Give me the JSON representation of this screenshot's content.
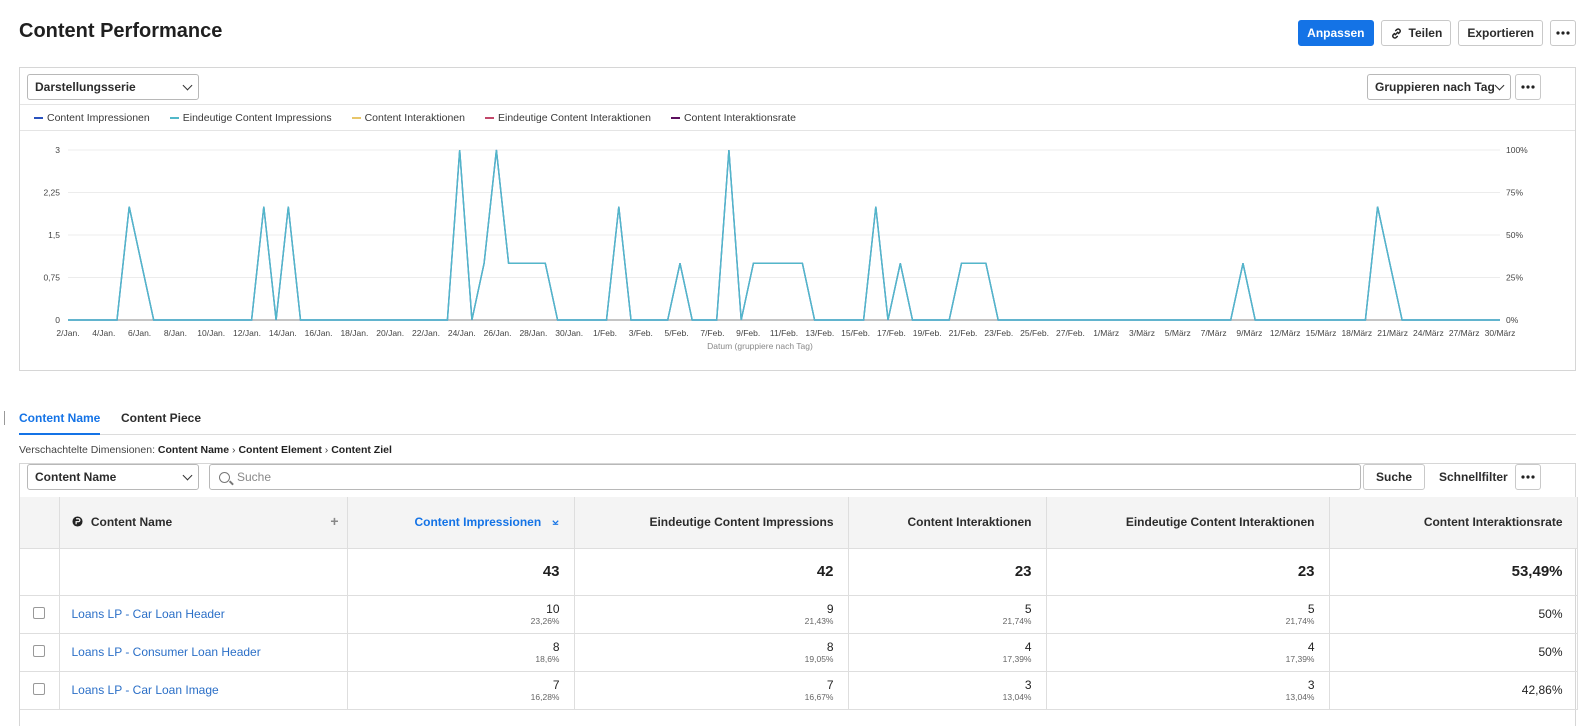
{
  "header": {
    "title": "Content Performance",
    "btn_customize": "Anpassen",
    "btn_share": "Teilen",
    "btn_export": "Exportieren",
    "more_icon": "more-icon"
  },
  "chart_panel": {
    "series_select": "Darstellungsserie",
    "group_select": "Gruppieren nach Tag"
  },
  "chart_data": {
    "type": "line",
    "xlabel": "Datum (gruppiere nach Tag)",
    "x_ticks": [
      "2/Jan.",
      "4/Jan.",
      "6/Jan.",
      "8/Jan.",
      "10/Jan.",
      "12/Jan.",
      "14/Jan.",
      "16/Jan.",
      "18/Jan.",
      "20/Jan.",
      "22/Jan.",
      "24/Jan.",
      "26/Jan.",
      "28/Jan.",
      "30/Jan.",
      "1/Feb.",
      "3/Feb.",
      "5/Feb.",
      "7/Feb.",
      "9/Feb.",
      "11/Feb.",
      "13/Feb.",
      "15/Feb.",
      "17/Feb.",
      "19/Feb.",
      "21/Feb.",
      "23/Feb.",
      "25/Feb.",
      "27/Feb.",
      "1/März",
      "3/März",
      "5/März",
      "7/März",
      "9/März",
      "12/März",
      "15/März",
      "18/März",
      "21/März",
      "24/März",
      "27/März",
      "30/März"
    ],
    "y_ticks_left": [
      "0",
      "0,75",
      "1,5",
      "2,25",
      "3"
    ],
    "y_ticks_right": [
      "0%",
      "25%",
      "50%",
      "75%",
      "100%"
    ],
    "ylim": [
      0,
      3
    ],
    "y2lim": [
      0,
      100
    ],
    "days": 89,
    "series": [
      {
        "name": "Content Impressionen",
        "color": "#2a52be",
        "values": [
          0,
          0,
          0,
          0,
          0,
          2,
          1,
          0,
          0,
          0,
          0,
          0,
          0,
          0,
          0,
          0,
          2,
          0,
          2,
          0,
          0,
          0,
          0,
          0,
          0,
          0,
          0,
          0,
          0,
          0,
          0,
          0,
          3,
          0,
          1,
          3,
          1,
          1,
          1,
          1,
          0,
          0,
          0,
          0,
          0,
          2,
          0,
          0,
          0,
          0,
          1,
          0,
          0,
          0,
          3,
          0,
          1,
          1,
          1,
          1,
          1,
          0,
          0,
          0,
          0,
          0,
          2,
          0,
          1,
          0,
          0,
          0,
          0,
          1,
          1,
          1,
          0,
          0,
          0,
          0,
          0,
          0,
          0,
          0,
          0,
          0,
          0,
          0,
          0,
          0,
          0,
          0,
          0,
          0,
          0,
          0,
          1,
          0,
          0,
          0,
          0,
          0,
          0,
          0,
          0,
          0,
          0,
          2,
          1,
          0,
          0,
          0,
          0,
          0,
          0,
          0,
          0,
          0
        ]
      },
      {
        "name": "Eindeutige Content Impressions",
        "color": "#52b8c9",
        "values": [
          0,
          0,
          0,
          0,
          0,
          2,
          1,
          0,
          0,
          0,
          0,
          0,
          0,
          0,
          0,
          0,
          2,
          0,
          2,
          0,
          0,
          0,
          0,
          0,
          0,
          0,
          0,
          0,
          0,
          0,
          0,
          0,
          3,
          0,
          1,
          3,
          1,
          1,
          1,
          1,
          0,
          0,
          0,
          0,
          0,
          2,
          0,
          0,
          0,
          0,
          1,
          0,
          0,
          0,
          3,
          0,
          1,
          1,
          1,
          1,
          1,
          0,
          0,
          0,
          0,
          0,
          2,
          0,
          1,
          0,
          0,
          0,
          0,
          1,
          1,
          1,
          0,
          0,
          0,
          0,
          0,
          0,
          0,
          0,
          0,
          0,
          0,
          0,
          0,
          0,
          0,
          0,
          0,
          0,
          0,
          0,
          1,
          0,
          0,
          0,
          0,
          0,
          0,
          0,
          0,
          0,
          0,
          2,
          1,
          0,
          0,
          0,
          0,
          0,
          0,
          0,
          0,
          0
        ]
      },
      {
        "name": "Content Interaktionen",
        "color": "#e8c66a",
        "values": []
      },
      {
        "name": "Eindeutige Content Interaktionen",
        "color": "#c2476a",
        "values": []
      },
      {
        "name": "Content Interaktionsrate",
        "color": "#5c0f5e",
        "values": []
      }
    ]
  },
  "tabs": {
    "tab1": "Content Name",
    "tab2": "Content Piece"
  },
  "breadcrumb": {
    "prefix": "Verschachtelte Dimensionen:",
    "d1": "Content Name",
    "d2": "Content Element",
    "d3": "Content Ziel",
    "sep": "›"
  },
  "table_panel": {
    "dimension_select": "Content Name",
    "search_placeholder": "Suche",
    "search_btn": "Suche",
    "quickfilter": "Schnellfilter"
  },
  "table": {
    "col_name": "Content Name",
    "columns": [
      "Content Impressionen",
      "Eindeutige Content Impressions",
      "Content Interaktionen",
      "Eindeutige Content Interaktionen",
      "Content Interaktionsrate"
    ],
    "totals": [
      "43",
      "42",
      "23",
      "23",
      "53,49%"
    ],
    "rows": [
      {
        "name": "Loans LP - Car Loan Header",
        "c1": "10",
        "p1": "23,26%",
        "c2": "9",
        "p2": "21,43%",
        "c3": "5",
        "p3": "21,74%",
        "c4": "5",
        "p4": "21,74%",
        "c5": "50%"
      },
      {
        "name": "Loans LP - Consumer Loan Header",
        "c1": "8",
        "p1": "18,6%",
        "c2": "8",
        "p2": "19,05%",
        "c3": "4",
        "p3": "17,39%",
        "c4": "4",
        "p4": "17,39%",
        "c5": "50%"
      },
      {
        "name": "Loans LP - Car Loan Image",
        "c1": "7",
        "p1": "16,28%",
        "c2": "7",
        "p2": "16,67%",
        "c3": "3",
        "p3": "13,04%",
        "c4": "3",
        "p4": "13,04%",
        "c5": "42,86%"
      }
    ]
  }
}
